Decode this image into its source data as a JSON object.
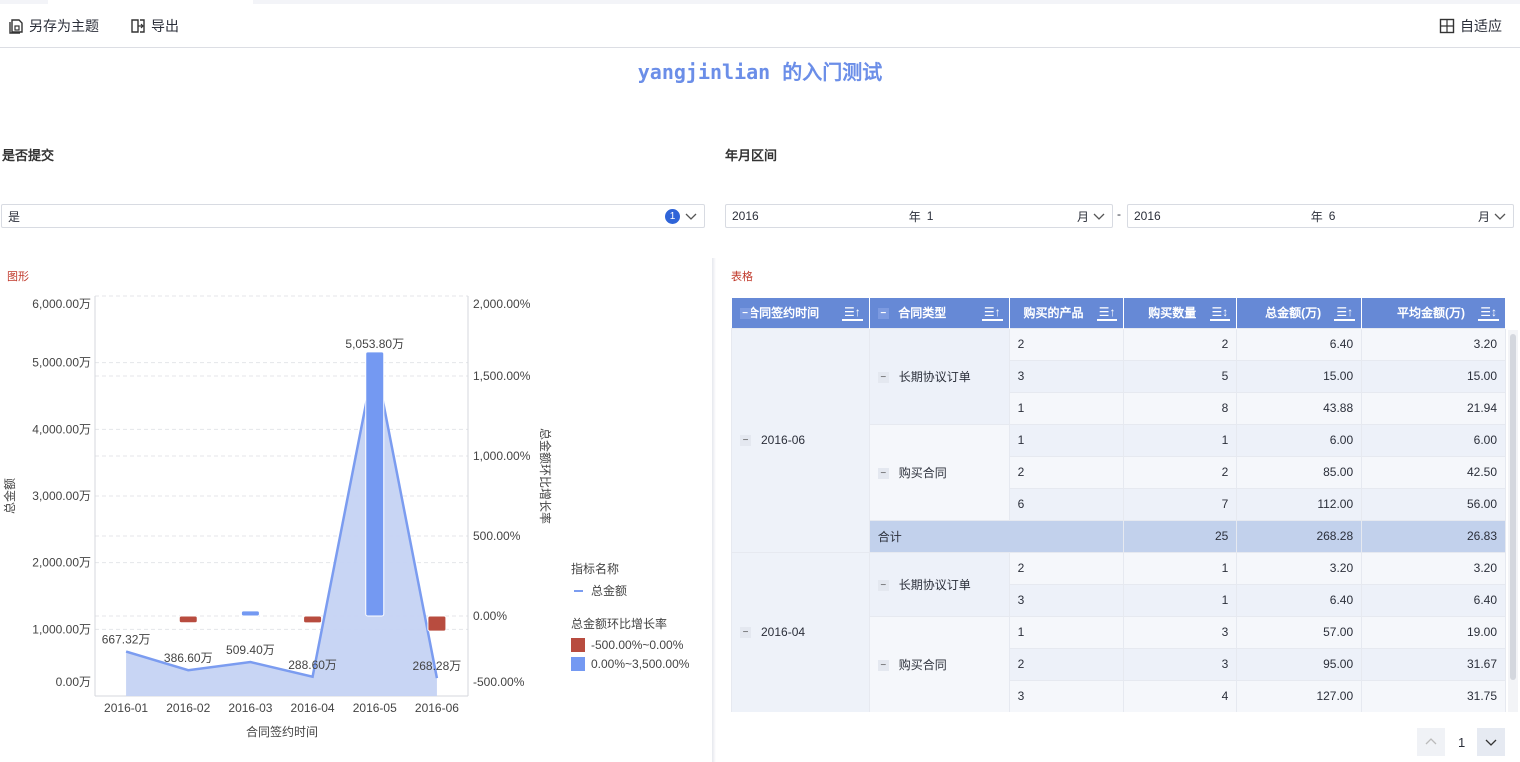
{
  "toolbar": {
    "save_theme": "另存为主题",
    "export": "导出",
    "adaptive": "自适应"
  },
  "title": "yangjinlian 的入门测试",
  "filters": {
    "submit": {
      "label": "是否提交",
      "value": "是",
      "count": "1"
    },
    "range": {
      "label": "年月区间",
      "from_year": "2016",
      "from_month": "1",
      "to_year": "2016",
      "to_month": "6",
      "year_unit": "年",
      "month_unit": "月",
      "sep": "-"
    }
  },
  "chart_panel_title": "图形",
  "table_panel_title": "表格",
  "colors": {
    "line": "#7b9cf0",
    "area": "#c5d3f3",
    "neg": "#b84c3f",
    "pos": "#7499f2",
    "header": "#6689d6"
  },
  "chart_data": {
    "type": "bar+area",
    "categories": [
      "2016-01",
      "2016-02",
      "2016-03",
      "2016-04",
      "2016-05",
      "2016-06"
    ],
    "series": [
      {
        "name": "总金额",
        "type": "area",
        "axis": "left",
        "values": [
          667.32,
          386.6,
          509.4,
          288.6,
          5053.8,
          268.28
        ],
        "labels": [
          "667.32万",
          "386.60万",
          "509.40万",
          "288.60万",
          "5,053.80万",
          "268.28万"
        ]
      },
      {
        "name": "总金额环比增长率",
        "type": "bar",
        "axis": "right",
        "values": [
          null,
          -42.07,
          31.76,
          -43.35,
          1651.14,
          -94.69
        ]
      }
    ],
    "xlabel": "合同签约时间",
    "ylabel": "总金额",
    "y2label": "总金额环比增长率",
    "ylim": [
      0,
      6000
    ],
    "y2lim": [
      -500,
      2000
    ],
    "yticks": [
      "0.00万",
      "1,000.00万",
      "2,000.00万",
      "3,000.00万",
      "4,000.00万",
      "5,000.00万",
      "6,000.00万"
    ],
    "y2ticks": [
      "-500.00%",
      "0.00%",
      "500.00%",
      "1,000.00%",
      "1,500.00%",
      "2,000.00%"
    ],
    "legend": {
      "title1": "指标名称",
      "item1": "总金额",
      "title2": "总金额环比增长率",
      "ranges": [
        "-500.00%~0.00%",
        "0.00%~3,500.00%"
      ]
    }
  },
  "table": {
    "headers": [
      "合同签约时间",
      "合同类型",
      "购买的产品",
      "购买数量",
      "总金额(万)",
      "平均金额(万)"
    ],
    "groups": [
      {
        "month": "2016-06",
        "types": [
          {
            "type": "长期协议订单",
            "rows": [
              [
                "2",
                "2",
                "6.40",
                "3.20"
              ],
              [
                "3",
                "5",
                "15.00",
                "15.00"
              ],
              [
                "1",
                "8",
                "43.88",
                "21.94"
              ]
            ]
          },
          {
            "type": "购买合同",
            "rows": [
              [
                "1",
                "1",
                "6.00",
                "6.00"
              ],
              [
                "2",
                "2",
                "85.00",
                "42.50"
              ],
              [
                "6",
                "7",
                "112.00",
                "56.00"
              ]
            ]
          }
        ],
        "total": {
          "label": "合计",
          "qty": "25",
          "amount": "268.28",
          "avg": "26.83"
        }
      },
      {
        "month": "2016-04",
        "types": [
          {
            "type": "长期协议订单",
            "rows": [
              [
                "2",
                "1",
                "3.20",
                "3.20"
              ],
              [
                "3",
                "1",
                "6.40",
                "6.40"
              ]
            ]
          },
          {
            "type": "购买合同",
            "rows": [
              [
                "1",
                "3",
                "57.00",
                "19.00"
              ],
              [
                "2",
                "3",
                "95.00",
                "31.67"
              ],
              [
                "3",
                "4",
                "127.00",
                "31.75"
              ]
            ]
          }
        ]
      }
    ]
  },
  "pagination": {
    "page": "1"
  }
}
